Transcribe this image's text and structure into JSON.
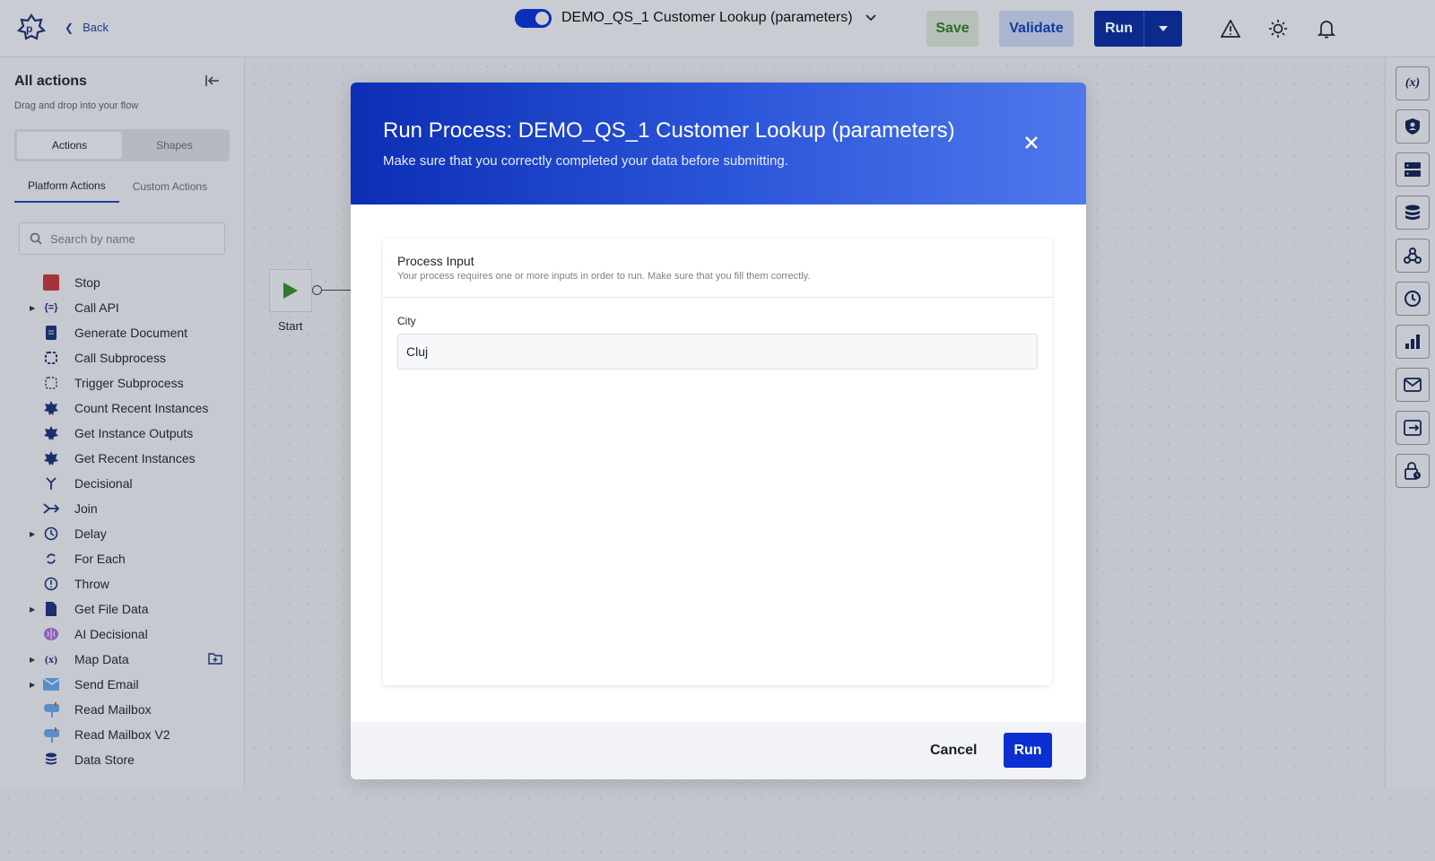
{
  "header": {
    "back_label": "Back",
    "process_title": "DEMO_QS_1 Customer Lookup (parameters)",
    "save_label": "Save",
    "validate_label": "Validate",
    "run_label": "Run"
  },
  "sidebar": {
    "title": "All actions",
    "subtitle": "Drag and drop into your flow",
    "segments": [
      "Actions",
      "Shapes"
    ],
    "tabs": [
      "Platform Actions",
      "Custom Actions"
    ],
    "search_placeholder": "Search by name",
    "items": [
      {
        "label": "Stop",
        "icon": "stop-icon",
        "expandable": false
      },
      {
        "label": "Call API",
        "icon": "api-icon",
        "expandable": true
      },
      {
        "label": "Generate Document",
        "icon": "document-icon",
        "expandable": false
      },
      {
        "label": "Call Subprocess",
        "icon": "subprocess-icon",
        "expandable": false
      },
      {
        "label": "Trigger Subprocess",
        "icon": "trigger-subprocess-icon",
        "expandable": false
      },
      {
        "label": "Count Recent Instances",
        "icon": "flowx-icon",
        "expandable": false
      },
      {
        "label": "Get Instance Outputs",
        "icon": "flowx-icon",
        "expandable": false
      },
      {
        "label": "Get Recent Instances",
        "icon": "flowx-icon",
        "expandable": false
      },
      {
        "label": "Decisional",
        "icon": "decisional-icon",
        "expandable": false
      },
      {
        "label": "Join",
        "icon": "join-icon",
        "expandable": false
      },
      {
        "label": "Delay",
        "icon": "clock-icon",
        "expandable": true
      },
      {
        "label": "For Each",
        "icon": "loop-icon",
        "expandable": false
      },
      {
        "label": "Throw",
        "icon": "exclamation-icon",
        "expandable": false
      },
      {
        "label": "Get File Data",
        "icon": "file-icon",
        "expandable": true
      },
      {
        "label": "AI Decisional",
        "icon": "brain-icon",
        "expandable": false
      },
      {
        "label": "Map Data",
        "icon": "variable-icon",
        "expandable": true
      },
      {
        "label": "Send Email",
        "icon": "email-icon",
        "expandable": true
      },
      {
        "label": "Read Mailbox",
        "icon": "mailbox-icon",
        "expandable": false
      },
      {
        "label": "Read Mailbox V2",
        "icon": "mailbox-icon",
        "expandable": false
      },
      {
        "label": "Data Store",
        "icon": "database-icon",
        "expandable": false
      }
    ]
  },
  "canvas": {
    "start_label": "Start"
  },
  "right_rail": {
    "icons": [
      "variable-icon",
      "shield-icon",
      "server-icon",
      "database-icon",
      "webhook-icon",
      "clock-icon",
      "chart-icon",
      "mail-icon",
      "export-icon",
      "lock-clock-icon"
    ],
    "variable_glyph": "(x)"
  },
  "modal": {
    "title": "Run Process: DEMO_QS_1 Customer Lookup (parameters)",
    "subtitle": "Make sure that you correctly completed your data before submitting.",
    "card_title": "Process Input",
    "card_subtitle": "Your process requires one or more inputs in order to run. Make sure that you fill them correctly.",
    "field_label": "City",
    "field_value": "Cluj",
    "cancel_label": "Cancel",
    "run_label": "Run"
  }
}
